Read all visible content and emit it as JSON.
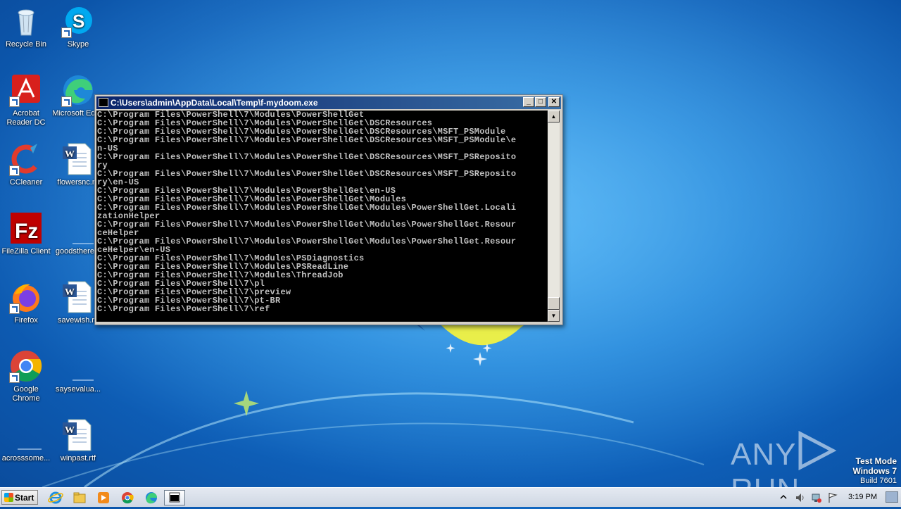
{
  "desktop_icons": [
    {
      "label": "Recycle Bin",
      "icon": "recycle-bin-icon"
    },
    {
      "label": "Skype",
      "icon": "skype-icon"
    },
    {
      "label": "Acrobat Reader DC",
      "icon": "acrobat-icon"
    },
    {
      "label": "Microsoft Edge",
      "icon": "edge-icon"
    },
    {
      "label": "CCleaner",
      "icon": "ccleaner-icon"
    },
    {
      "label": "flowersnc.rtf",
      "icon": "word-document-icon"
    },
    {
      "label": "FileZilla Client",
      "icon": "filezilla-icon"
    },
    {
      "label": "goodsthere...",
      "icon": "blank-file-icon"
    },
    {
      "label": "Firefox",
      "icon": "firefox-icon"
    },
    {
      "label": "savewish.rtf",
      "icon": "word-document-icon"
    },
    {
      "label": "Google Chrome",
      "icon": "chrome-icon"
    },
    {
      "label": "saysevalua...",
      "icon": "blank-file-icon"
    },
    {
      "label": "acrosssome...",
      "icon": "blank-file-icon"
    },
    {
      "label": "winpast.rtf",
      "icon": "word-document-icon"
    }
  ],
  "console": {
    "title": "C:\\Users\\admin\\AppData\\Local\\Temp\\f-mydoom.exe",
    "lines": [
      "C:\\Program Files\\PowerShell\\7\\Modules\\PowerShellGet",
      "C:\\Program Files\\PowerShell\\7\\Modules\\PowerShellGet\\DSCResources",
      "C:\\Program Files\\PowerShell\\7\\Modules\\PowerShellGet\\DSCResources\\MSFT_PSModule",
      "C:\\Program Files\\PowerShell\\7\\Modules\\PowerShellGet\\DSCResources\\MSFT_PSModule\\e",
      "n-US",
      "C:\\Program Files\\PowerShell\\7\\Modules\\PowerShellGet\\DSCResources\\MSFT_PSReposito",
      "ry",
      "C:\\Program Files\\PowerShell\\7\\Modules\\PowerShellGet\\DSCResources\\MSFT_PSReposito",
      "ry\\en-US",
      "C:\\Program Files\\PowerShell\\7\\Modules\\PowerShellGet\\en-US",
      "C:\\Program Files\\PowerShell\\7\\Modules\\PowerShellGet\\Modules",
      "C:\\Program Files\\PowerShell\\7\\Modules\\PowerShellGet\\Modules\\PowerShellGet.Locali",
      "zationHelper",
      "C:\\Program Files\\PowerShell\\7\\Modules\\PowerShellGet\\Modules\\PowerShellGet.Resour",
      "ceHelper",
      "C:\\Program Files\\PowerShell\\7\\Modules\\PowerShellGet\\Modules\\PowerShellGet.Resour",
      "ceHelper\\en-US",
      "C:\\Program Files\\PowerShell\\7\\Modules\\PSDiagnostics",
      "C:\\Program Files\\PowerShell\\7\\Modules\\PSReadLine",
      "C:\\Program Files\\PowerShell\\7\\Modules\\ThreadJob",
      "C:\\Program Files\\PowerShell\\7\\pl",
      "C:\\Program Files\\PowerShell\\7\\preview",
      "C:\\Program Files\\PowerShell\\7\\pt-BR",
      "C:\\Program Files\\PowerShell\\7\\ref"
    ],
    "text": ""
  },
  "watermark": {
    "brand_left": "ANY",
    "brand_right": "RUN"
  },
  "test_mode": {
    "line1": "Test Mode",
    "line2": "Windows 7",
    "line3": "Build 7601"
  },
  "taskbar": {
    "start_label": "Start",
    "pinned": [
      "internet-explorer-icon",
      "file-explorer-icon",
      "media-player-icon",
      "chrome-icon",
      "edge-icon",
      "console-window-icon"
    ],
    "clock": "3:19 PM"
  }
}
